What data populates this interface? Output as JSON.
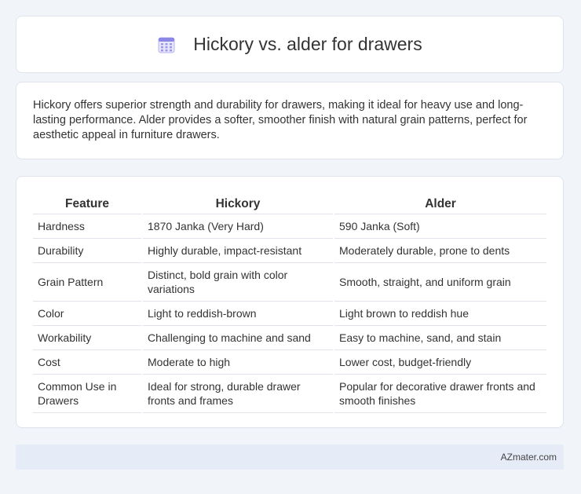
{
  "title": "Hickory vs. alder for drawers",
  "icon": "calendar-icon",
  "summary": "Hickory offers superior strength and durability for drawers, making it ideal for heavy use and long-lasting performance. Alder provides a softer, smoother finish with natural grain patterns, perfect for aesthetic appeal in furniture drawers.",
  "table": {
    "headers": [
      "Feature",
      "Hickory",
      "Alder"
    ],
    "rows": [
      [
        "Hardness",
        "1870 Janka (Very Hard)",
        "590 Janka (Soft)"
      ],
      [
        "Durability",
        "Highly durable, impact-resistant",
        "Moderately durable, prone to dents"
      ],
      [
        "Grain Pattern",
        "Distinct, bold grain with color variations",
        "Smooth, straight, and uniform grain"
      ],
      [
        "Color",
        "Light to reddish-brown",
        "Light brown to reddish hue"
      ],
      [
        "Workability",
        "Challenging to machine and sand",
        "Easy to machine, sand, and stain"
      ],
      [
        "Cost",
        "Moderate to high",
        "Lower cost, budget-friendly"
      ],
      [
        "Common Use in Drawers",
        "Ideal for strong, durable drawer fronts and frames",
        "Popular for decorative drawer fronts and smooth finishes"
      ]
    ]
  },
  "footer": "AZmater.com"
}
